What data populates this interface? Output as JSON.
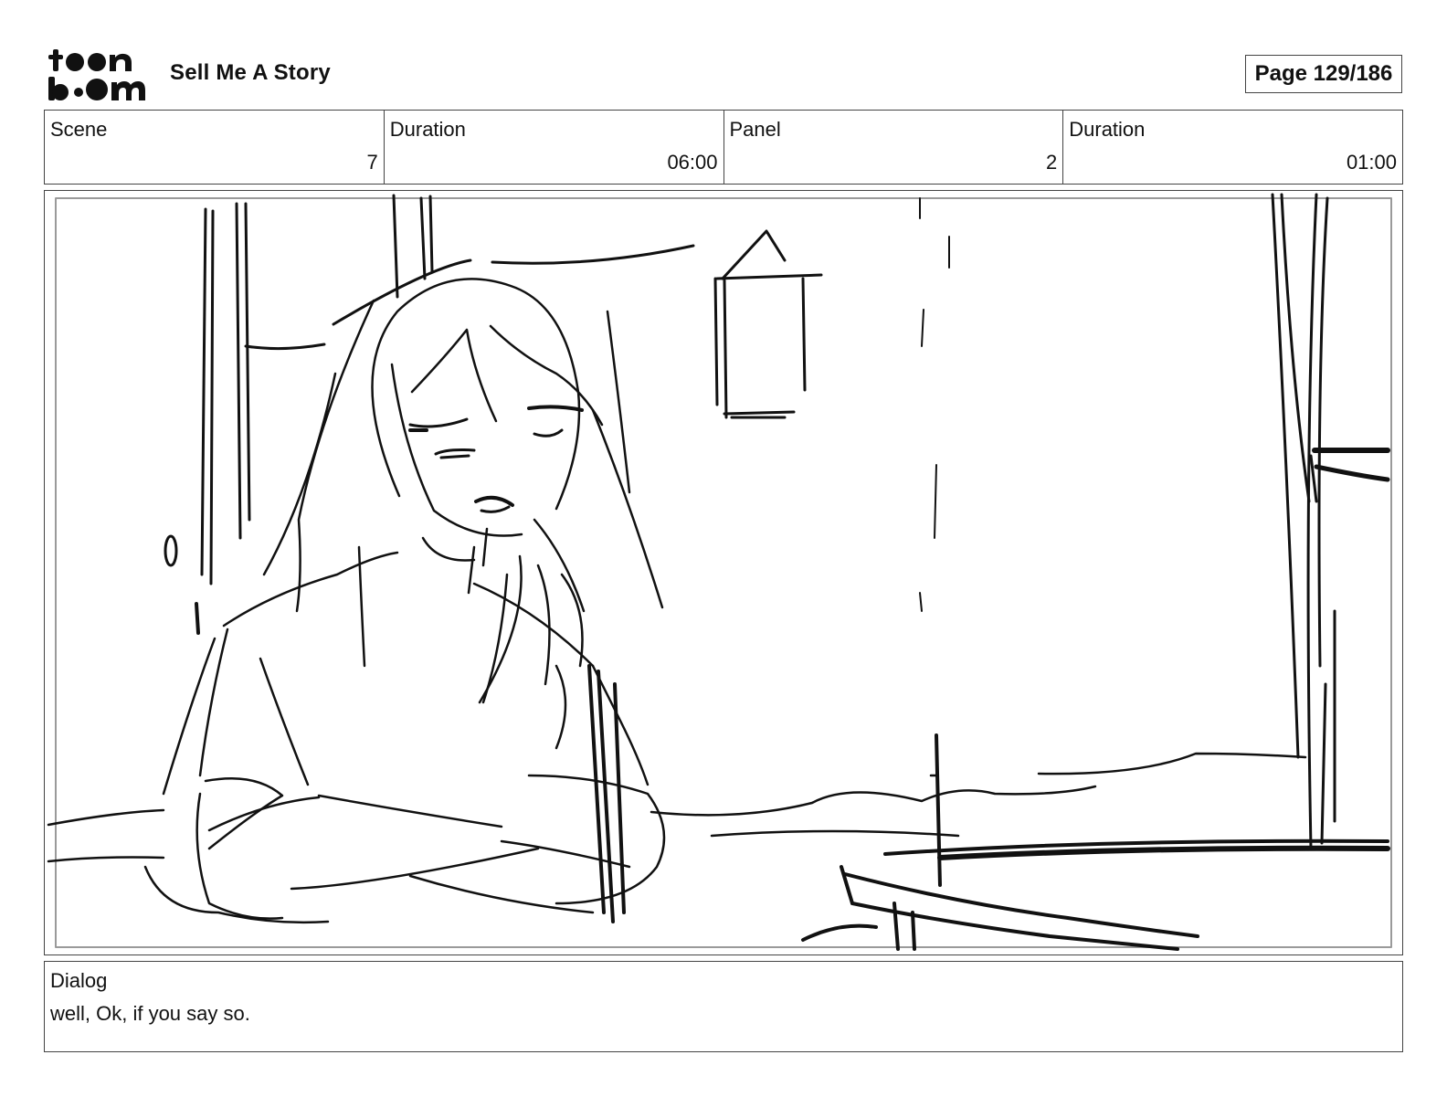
{
  "logo": {
    "icon": "toonboom-logo",
    "text_line1": "toon",
    "text_line2": "boom"
  },
  "header": {
    "project_title": "Sell Me A Story",
    "page_indicator": "Page 129/186"
  },
  "info": {
    "scene_label": "Scene",
    "scene_value": "7",
    "scene_duration_label": "Duration",
    "scene_duration_value": "06:00",
    "panel_label": "Panel",
    "panel_value": "2",
    "panel_duration_label": "Duration",
    "panel_duration_value": "01:00"
  },
  "panel": {
    "image": "storyboard-sketch"
  },
  "dialog": {
    "label": "Dialog",
    "text": "well, Ok, if you say so."
  }
}
